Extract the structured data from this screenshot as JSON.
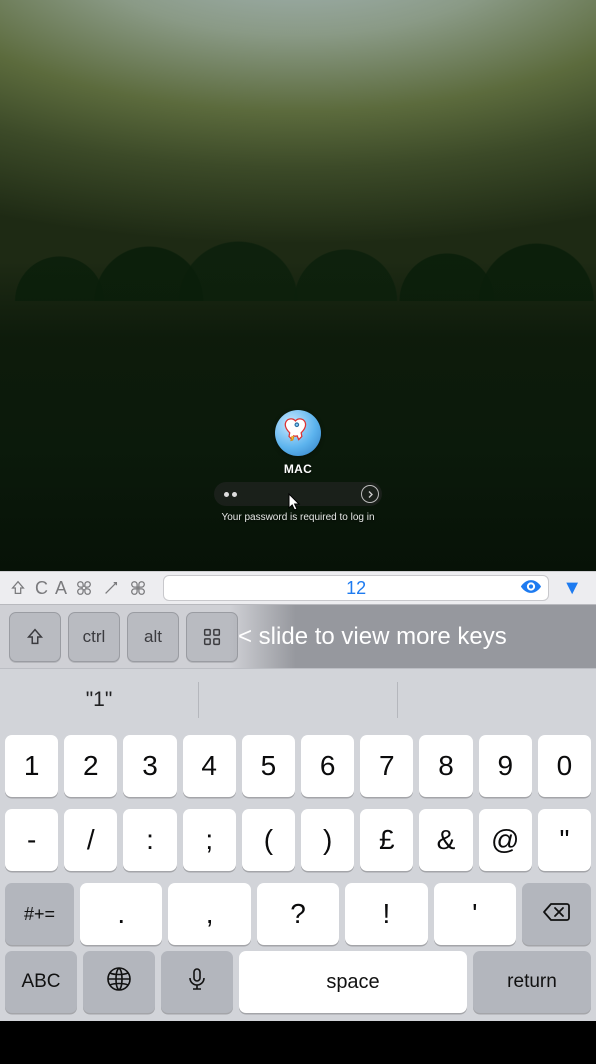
{
  "login": {
    "username": "MAC",
    "password_masked_char_count": 2,
    "hint": "Your password is required to log in"
  },
  "toolbar": {
    "input_value": "12"
  },
  "mod_keys": {
    "shift": "⇧",
    "ctrl": "ctrl",
    "alt": "alt",
    "slide_hint": "< slide to view more keys"
  },
  "predictive": {
    "suggestion": "\"1\""
  },
  "keyboard": {
    "row1": [
      "1",
      "2",
      "3",
      "4",
      "5",
      "6",
      "7",
      "8",
      "9",
      "0"
    ],
    "row2": [
      "-",
      "/",
      ":",
      ";",
      "(",
      ")",
      "£",
      "&",
      "@",
      "\""
    ],
    "row3_mode": "#+=",
    "row3_punc": [
      ".",
      ",",
      "?",
      "!",
      "'"
    ],
    "bottom": {
      "abc": "ABC",
      "space": "space",
      "return": "return"
    }
  }
}
